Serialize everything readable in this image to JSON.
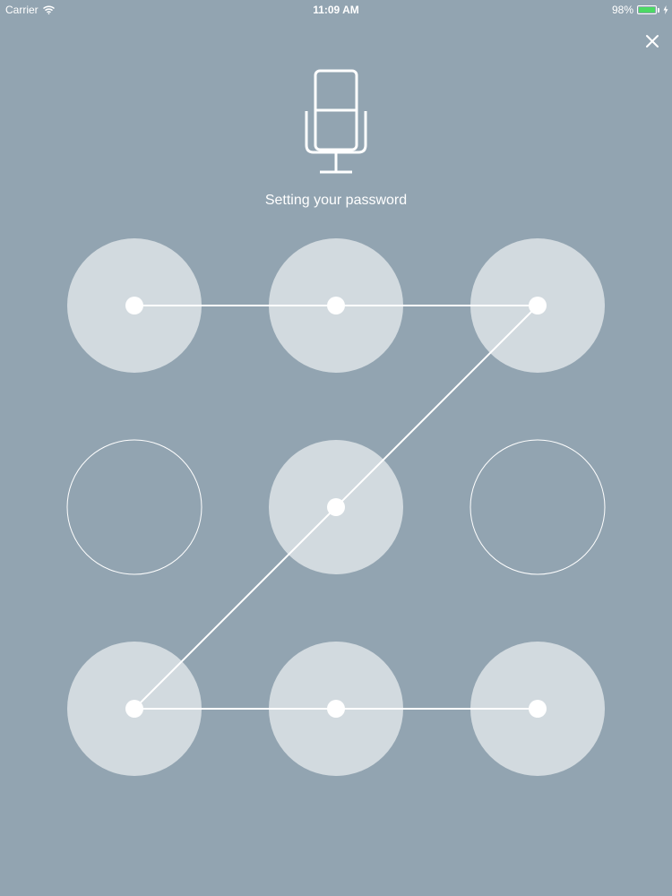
{
  "status_bar": {
    "carrier": "Carrier",
    "time": "11:09 AM",
    "battery_text": "98%",
    "battery_level": 0.98,
    "wifi_icon": "wifi-icon",
    "battery_icon": "battery-icon",
    "charging_icon": "charging-bolt-icon"
  },
  "close_icon": "close-icon",
  "header_icon": "microphone-icon",
  "title": "Setting your password",
  "pattern": {
    "grid": [
      3,
      3
    ],
    "selected_nodes": [
      0,
      1,
      2,
      4,
      6,
      7,
      8
    ],
    "path": [
      0,
      1,
      2,
      4,
      6,
      7,
      8
    ]
  },
  "colors": {
    "background": "#92a4b1",
    "node_selected_fill": "#d8dee3",
    "node_outline": "#ffffff",
    "battery_fill": "#4cd964"
  }
}
